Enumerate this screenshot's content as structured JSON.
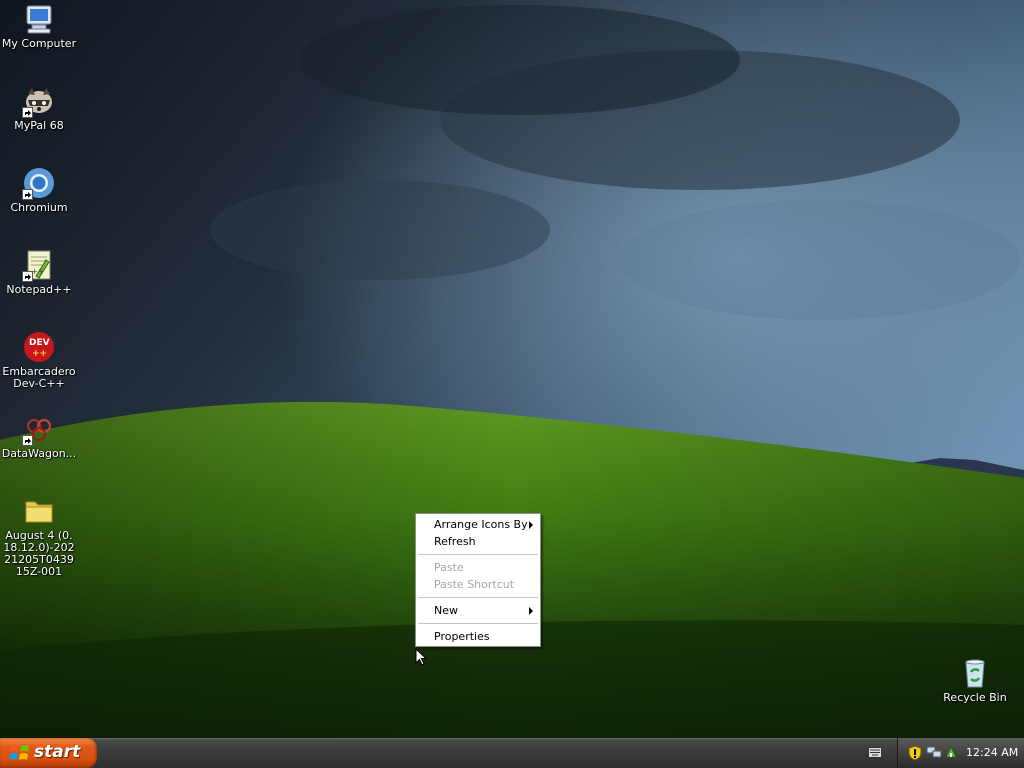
{
  "desktop": {
    "icons": [
      {
        "label": "My Computer",
        "icon": "my-computer-icon",
        "shortcut": false
      },
      {
        "label": "MyPal 68",
        "icon": "mypal-icon",
        "shortcut": true
      },
      {
        "label": "Chromium",
        "icon": "chromium-icon",
        "shortcut": true
      },
      {
        "label": "Notepad++",
        "icon": "notepadpp-icon",
        "shortcut": true
      },
      {
        "label": "Embarcadero Dev-C++",
        "icon": "devcpp-icon",
        "shortcut": false
      },
      {
        "label": "DataWagon...",
        "icon": "datawagon-icon",
        "shortcut": true
      },
      {
        "label": "August 4 (0.18.12.0)-20221205T043915Z-001",
        "icon": "folder-icon",
        "shortcut": false
      }
    ],
    "recycle_bin": {
      "label": "Recycle Bin",
      "icon": "recycle-bin-icon"
    }
  },
  "context_menu": {
    "items": [
      {
        "label": "Arrange Icons By",
        "enabled": true,
        "submenu": true
      },
      {
        "label": "Refresh",
        "enabled": true,
        "submenu": false
      },
      {
        "label": "Paste",
        "enabled": false,
        "submenu": false
      },
      {
        "label": "Paste Shortcut",
        "enabled": false,
        "submenu": false
      },
      {
        "label": "New",
        "enabled": true,
        "submenu": true
      },
      {
        "label": "Properties",
        "enabled": true,
        "submenu": false
      }
    ]
  },
  "taskbar": {
    "start_label": "start",
    "clock": "12:24 AM",
    "tray_icons": [
      "security-shield-icon",
      "network-icon",
      "safely-remove-icon"
    ],
    "keyboard_icon": "keyboard-icon"
  },
  "colors": {
    "start_button": "#d8500f",
    "taskbar": "#3a3a3a",
    "menu_disabled_text": "#a7a6aa"
  }
}
